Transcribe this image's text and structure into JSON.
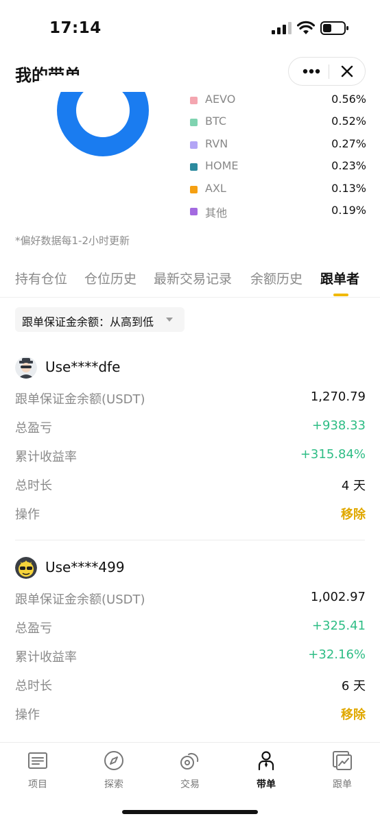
{
  "status": {
    "time": "17:14"
  },
  "header": {
    "title": "我的带单"
  },
  "legend": [
    {
      "name": "AEVO",
      "pct": "0.56%",
      "color": "#f4a6b0"
    },
    {
      "name": "BTC",
      "pct": "0.52%",
      "color": "#7fd3b0"
    },
    {
      "name": "RVN",
      "pct": "0.27%",
      "color": "#b3a5f5"
    },
    {
      "name": "HOME",
      "pct": "0.23%",
      "color": "#2c8a9e"
    },
    {
      "name": "AXL",
      "pct": "0.13%",
      "color": "#f5a012"
    },
    {
      "name": "其他",
      "pct": "0.19%",
      "color": "#a36ae0"
    }
  ],
  "donut_color": "#1a7cf0",
  "footnote": "*偏好数据每1-2小时更新",
  "tabs": [
    {
      "label": "持有仓位"
    },
    {
      "label": "仓位历史"
    },
    {
      "label": "最新交易记录"
    },
    {
      "label": "余额历史"
    },
    {
      "label": "跟单者"
    }
  ],
  "sort": {
    "label": "跟单保证金余额：从高到低"
  },
  "followers": [
    {
      "username": "Use****dfe",
      "rows": [
        {
          "label": "跟单保证金余额(USDT)",
          "value": "1,270.79"
        },
        {
          "label": "总盈亏",
          "value": "+938.33"
        },
        {
          "label": "累计收益率",
          "value": "+315.84%"
        },
        {
          "label": "总时长",
          "value": "4 天"
        },
        {
          "label": "操作",
          "value": "移除"
        }
      ]
    },
    {
      "username": "Use****499",
      "rows": [
        {
          "label": "跟单保证金余额(USDT)",
          "value": "1,002.97"
        },
        {
          "label": "总盈亏",
          "value": "+325.41"
        },
        {
          "label": "累计收益率",
          "value": "+32.16%"
        },
        {
          "label": "总时长",
          "value": "6 天"
        },
        {
          "label": "操作",
          "value": "移除"
        }
      ]
    }
  ],
  "nav": [
    {
      "label": "项目",
      "icon": "list-icon"
    },
    {
      "label": "探索",
      "icon": "compass-icon"
    },
    {
      "label": "交易",
      "icon": "exchange-icon"
    },
    {
      "label": "带单",
      "icon": "lead-trader-icon"
    },
    {
      "label": "跟单",
      "icon": "copy-chart-icon"
    }
  ]
}
